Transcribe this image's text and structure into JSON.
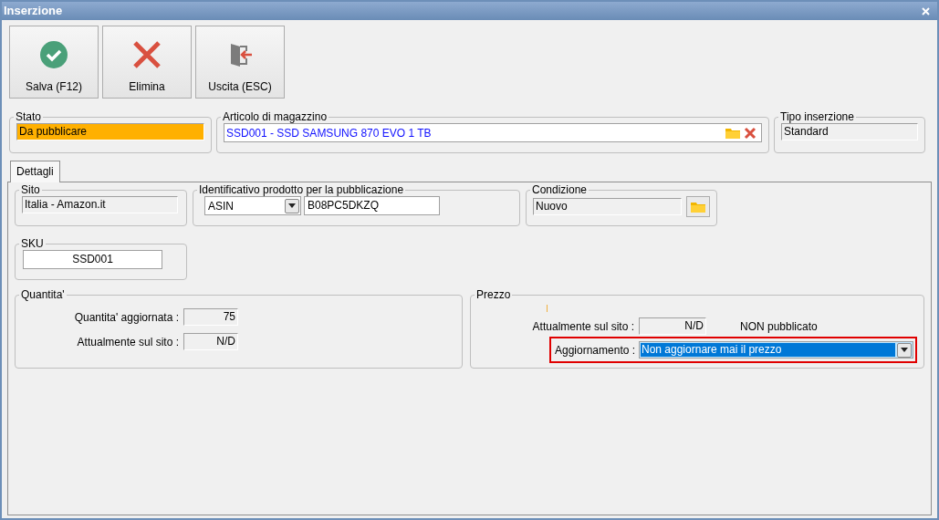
{
  "window": {
    "title": "Inserzione"
  },
  "toolbar": [
    {
      "kind": "save",
      "label": "Salva (F12)"
    },
    {
      "kind": "delete",
      "label": "Elimina"
    },
    {
      "kind": "exit",
      "label": "Uscita (ESC)"
    }
  ],
  "stato": {
    "label": "Stato",
    "value": "Da pubblicare"
  },
  "articolo": {
    "label": "Articolo di magazzino",
    "value": "SSD001 - SSD SAMSUNG 870 EVO 1 TB"
  },
  "tipo": {
    "label": "Tipo inserzione",
    "value": "Standard"
  },
  "tabs": [
    {
      "label": "Dettagli",
      "selected": true
    }
  ],
  "sito": {
    "label": "Sito",
    "value": "Italia - Amazon.it"
  },
  "identificativo": {
    "label": "Identificativo prodotto per la pubblicazione",
    "type": "ASIN",
    "code": "B08PC5DKZQ"
  },
  "condizione": {
    "label": "Condizione",
    "value": "Nuovo"
  },
  "sku": {
    "label": "SKU",
    "value": "SSD001"
  },
  "quantita": {
    "label": "Quantita'",
    "rows": [
      {
        "label": "Quantita' aggiornata :",
        "value": "75"
      },
      {
        "label": "Attualmente sul sito :",
        "value": "N/D"
      }
    ]
  },
  "prezzo": {
    "label": "Prezzo",
    "current_label": "Attualmente sul sito :",
    "current_value": "N/D",
    "status": "NON pubblicato",
    "update_label": "Aggiornamento :",
    "update_value": "Non aggiornare mai il prezzo",
    "highlighted": true
  }
}
